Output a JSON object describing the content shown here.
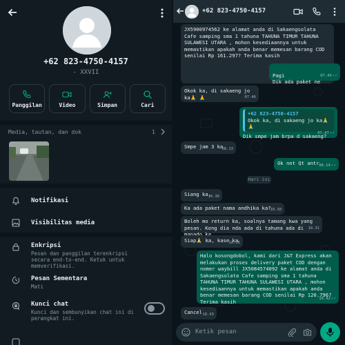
{
  "contact": {
    "number": "+62 823-4750-4157",
    "about": "- XXVII"
  },
  "actions": [
    {
      "label": "Panggilan",
      "icon": "phone-icon"
    },
    {
      "label": "Video",
      "icon": "video-icon"
    },
    {
      "label": "Simpan",
      "icon": "add-contact-icon"
    },
    {
      "label": "Cari",
      "icon": "search-icon"
    }
  ],
  "media": {
    "title": "Media, tautan, dan dok",
    "count": "1"
  },
  "settings": [
    {
      "title": "Notifikasi",
      "icon": "bell-icon"
    },
    {
      "title": "Visibilitas media",
      "icon": "image-icon"
    }
  ],
  "privacy": [
    {
      "title": "Enkripsi",
      "sub": "Pesan dan panggilan terenkripsi secara end-to-end. Ketuk untuk memverifikasi.",
      "icon": "lock-icon"
    },
    {
      "title": "Pesan Sementara",
      "sub": "Mati",
      "icon": "timer-icon"
    },
    {
      "title": "Kunci chat",
      "sub": "Kunci dan sembunyikan chat ini di perangkat ini.",
      "icon": "chat-lock-icon",
      "toggle": false
    }
  ],
  "chat": {
    "header_name": "+62 823-4750-4157",
    "day_separator": "Hari ini",
    "input_placeholder": "Ketik pesan",
    "messages": [
      {
        "dir": "in",
        "text": "JX5900974562 ke alamat anda di Sakaengsolata Cafe samping sma 1 tahuna TAHUNA TIMUR TAHUNA SULAWESI UTARA , mohon kesediaannya untuk memastikan apakah anda benar memesan barang COD senilai Rp 161.297? Terima kasih",
        "time": "07.45"
      },
      {
        "dir": "out",
        "text": "Pagi\nDik ada paket ne",
        "time": "07.45"
      },
      {
        "dir": "in",
        "text": "Okok ka, di sakaeng jo ka🙏 🙏",
        "time": "07.46"
      },
      {
        "dir": "out",
        "quote_name": "+62 823-4750-4157",
        "quote_text": "Okok ka, di sakaeng jo ka🙏 🙏",
        "text": "Dik smpe jam brpa d sakaeng?",
        "time": "07.47"
      },
      {
        "dir": "in",
        "text": "Smpe jam 3 ka",
        "time": "08.13"
      },
      {
        "dir": "out",
        "text": "Ok nnt Qt antr",
        "time": "08.14"
      },
      {
        "dir": "in",
        "text": "Siang ka.",
        "time": "10.30"
      },
      {
        "dir": "in",
        "text": "Ka ada paket nama andhika ka?",
        "time": "10.30"
      },
      {
        "dir": "in",
        "text": "Boleh mo return ka, soalnya    tamang kwa yang pesan. Kong dia nda ada di tahuna ada di manado ka",
        "time": "10.31"
      },
      {
        "dir": "in",
        "text": "Siap🙏 ka, kase ka",
        "time": "10.36"
      },
      {
        "dir": "out",
        "text": "Halo kosongdobol, kami dari J&T Express akan melakukan proses delivery paket COD dengan nomer waybill JX5084574092 ke alamat anda di Sakaengsolata Cafe samping sma 1 tahuna TAHUNA TIMUR TAHUNA SULAWESI UTARA , mohon kesediaannya untuk memastikan apakah anda benar memesan barang COD senilai Rp 120.796? Terima kasih",
        "time": "10.42"
      },
      {
        "dir": "in",
        "text": "Cancel",
        "time": "10.43"
      }
    ]
  }
}
